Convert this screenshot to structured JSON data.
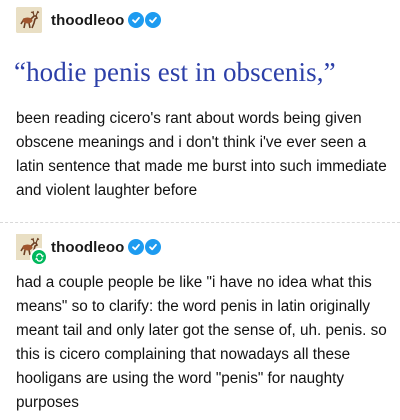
{
  "post1": {
    "username": "thoodleoo",
    "quote": "“hodie penis est in obscenis,”",
    "body": "been reading cicero's rant about words being given obscene meanings and i don't think i've ever seen a latin sentence that made me burst into such immediate and violent laughter before"
  },
  "post2": {
    "username": "thoodleoo",
    "body": "had a couple people be like \"i have no idea what this means\" so to clarify: the word penis in latin originally meant tail and only later got the sense of, uh. penis. so this is cicero complaining that nowadays all these hooligans are using the word \"penis\" for naughty purposes"
  },
  "icons": {
    "avatar": "medieval-deer-avatar",
    "verified_badges": [
      "verified-checkmark-icon",
      "verified-checkmark-icon"
    ],
    "reblog": "reblog-icon"
  },
  "colors": {
    "quote_blue": "#2c3fa8",
    "badge_blue": "#1d9bf0",
    "reblog_green": "#00b85c"
  }
}
